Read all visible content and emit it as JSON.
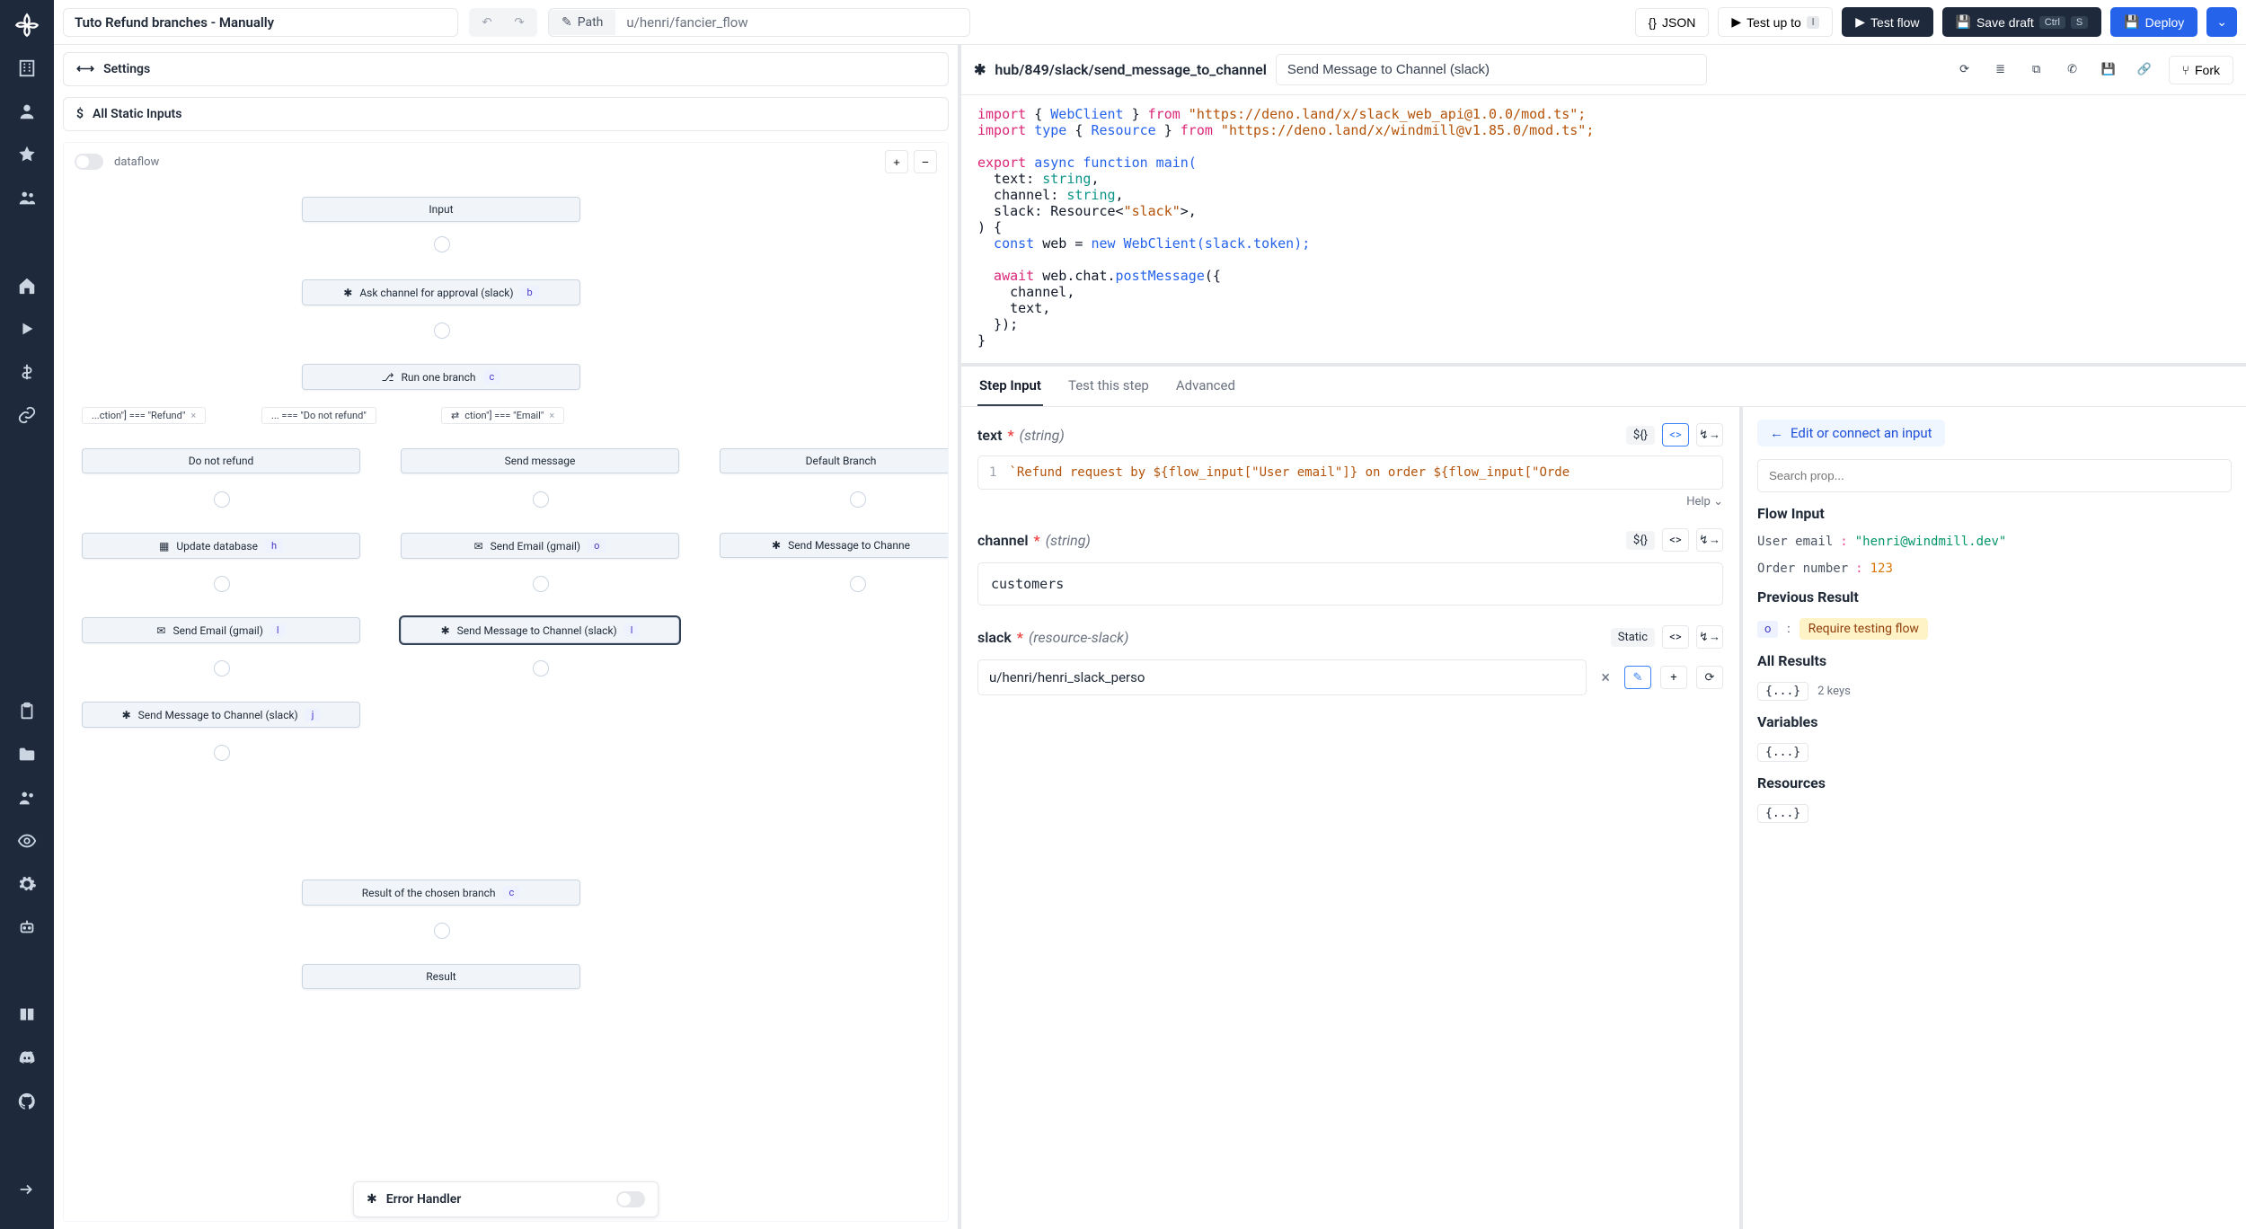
{
  "toolbar": {
    "title": "Tuto Refund branches - Manually",
    "path_label": "Path",
    "path_value": "u/henri/fancier_flow",
    "json": "JSON",
    "test_up_to": "Test up to",
    "test_up_to_key": "l",
    "test_flow": "Test flow",
    "save_draft": "Save draft",
    "save_kbd1": "Ctrl",
    "save_kbd2": "S",
    "deploy": "Deploy"
  },
  "flow_panel": {
    "settings": "Settings",
    "all_static_inputs": "All Static Inputs",
    "dataflow": "dataflow",
    "error_handler": "Error Handler"
  },
  "nodes": {
    "input": "Input",
    "ask_channel": "Ask channel for approval (slack)",
    "ask_channel_key": "b",
    "run_one_branch": "Run one branch",
    "run_one_branch_key": "c",
    "branch_refund": "...ction\"] === \"Refund\"",
    "branch_no_refund": "... === \"Do not refund\"",
    "branch_email": "ction\"] === \"Email\"",
    "do_not_refund": "Do not refund",
    "send_message": "Send message",
    "default_branch": "Default Branch",
    "update_db": "Update database",
    "update_db_key": "h",
    "send_email_g": "Send Email (gmail)",
    "send_email_key_o": "o",
    "send_msg_ch": "Send Message to Channe",
    "send_email_key_l": "l",
    "send_msg_ch_full": "Send Message to Channel (slack)",
    "send_msg_key_l": "l",
    "send_msg_key_j": "j",
    "result_chosen": "Result of the chosen branch",
    "result_chosen_key": "c",
    "result": "Result"
  },
  "step_header": {
    "path": "hub/849/slack/send_message_to_channel",
    "summary": "Send Message to Channel (slack)",
    "fork": "Fork"
  },
  "code": {
    "l1a": "import",
    "l1b": "{ ",
    "l1c": "WebClient",
    "l1d": " } ",
    "l1e": "from",
    "l1f": " \"https://deno.land/x/slack_web_api@1.0.0/mod.ts\";",
    "l2a": "import",
    "l2b": " type",
    "l2c": " { ",
    "l2d": "Resource",
    "l2e": " } ",
    "l2f": "from",
    "l2g": " \"https://deno.land/x/windmill@v1.85.0/mod.ts\";",
    "l4a": "export",
    "l4b": " async",
    "l4c": " function",
    "l4d": " main(",
    "l5": "  text: ",
    "l5t": "string",
    "l5e": ",",
    "l6": "  channel: ",
    "l6t": "string",
    "l6e": ",",
    "l7": "  slack: Resource<",
    "l7s": "\"slack\"",
    "l7e": ">,",
    "l8": ") {",
    "l9a": "  const",
    "l9b": " web = ",
    "l9c": "new",
    "l9d": " WebClient(slack.token);",
    "l11a": "  await",
    "l11b": " web.chat.",
    "l11c": "postMessage",
    "l11d": "({",
    "l12": "    channel,",
    "l13": "    text,",
    "l14": "  });",
    "l15": "}"
  },
  "tabs": {
    "input": "Step Input",
    "test": "Test this step",
    "adv": "Advanced"
  },
  "form": {
    "text_label": "text",
    "text_type": "(string)",
    "expr_badge": "${}",
    "text_expr_line": "1",
    "text_expr": "`Refund request by ${flow_input[\"User email\"]} on order ${flow_input[\"Orde",
    "help": "Help",
    "channel_label": "channel",
    "channel_type": "(string)",
    "channel_value": "customers",
    "slack_label": "slack",
    "slack_type": "(resource-slack)",
    "static": "Static",
    "slack_value": "u/henri/henri_slack_perso"
  },
  "inspector": {
    "edit": "Edit or connect an input",
    "search_ph": "Search prop...",
    "flow_input": "Flow Input",
    "user_email_k": "User email",
    "user_email_v": "\"henri@windmill.dev\"",
    "order_k": "Order number",
    "order_v": "123",
    "prev_result": "Previous Result",
    "prev_key": "o",
    "require_testing": "Require testing flow",
    "all_results": "All Results",
    "two_keys": "2 keys",
    "variables": "Variables",
    "resources": "Resources",
    "obj": "{...}"
  }
}
